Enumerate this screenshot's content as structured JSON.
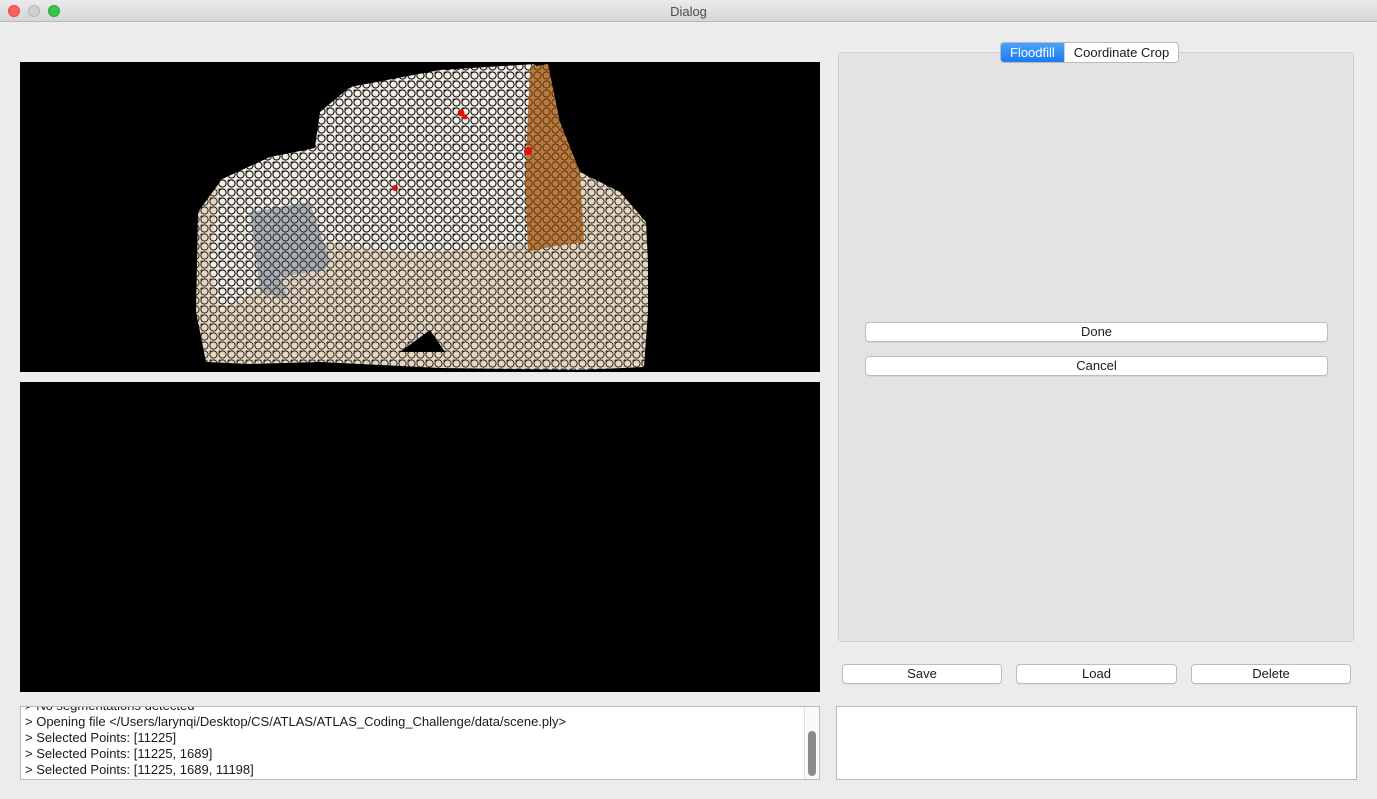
{
  "window": {
    "title": "Dialog"
  },
  "tabs": [
    {
      "label": "Floodfill",
      "active": true
    },
    {
      "label": "Coordinate Crop",
      "active": false
    }
  ],
  "floodfill": {
    "done_label": "Done",
    "cancel_label": "Cancel"
  },
  "actions": {
    "save_label": "Save",
    "load_label": "Load",
    "delete_label": "Delete"
  },
  "log": {
    "lines": [
      "> No segmentations detected",
      "> Opening file </Users/larynqi/Desktop/CS/ATLAS/ATLAS_Coding_Challenge/data/scene.ply>",
      "> Selected Points: [11225]",
      "> Selected Points: [11225, 1689]",
      "> Selected Points: [11225, 1689, 11198]"
    ]
  },
  "viewer": {
    "background": "#000000",
    "selected_point_color": "#e01010",
    "highlight_color": "#b87a3e"
  },
  "colors": {
    "tab_active": "#1a7cf5",
    "window_bg": "#ececec",
    "panel_bg": "#e3e3e3"
  }
}
